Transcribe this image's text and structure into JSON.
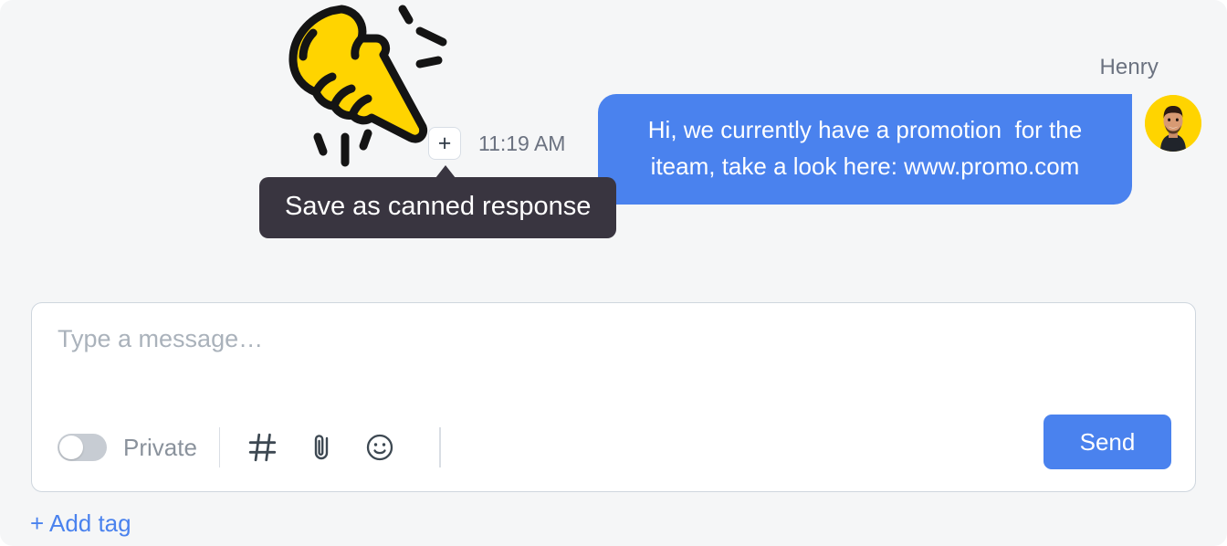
{
  "theme": {
    "background": "#f5f6f7",
    "accent": "#4a82ee",
    "tooltip_bg": "#393540",
    "hand_yellow": "#ffd400",
    "icon_color": "#3d4852",
    "muted_text": "#6b7280"
  },
  "conversation": {
    "sender_name": "Henry",
    "message": "Hi, we currently have a promotion  for the iteam, take a look here: www.promo.com",
    "timestamp": "11:19 AM",
    "plus_button_label": "+",
    "avatar_alt": "Henry avatar"
  },
  "tooltip": {
    "text": "Save as canned response"
  },
  "composer": {
    "placeholder": "Type a message…",
    "value": "",
    "toggle": {
      "label": "Private",
      "state": "off"
    },
    "icons": [
      {
        "name": "hash-icon",
        "label": "#"
      },
      {
        "name": "attachment-icon",
        "label": "Attach file"
      },
      {
        "name": "emoji-icon",
        "label": "Emoji"
      }
    ],
    "send_label": "Send"
  },
  "footer": {
    "add_tag_label": "+ Add tag"
  }
}
